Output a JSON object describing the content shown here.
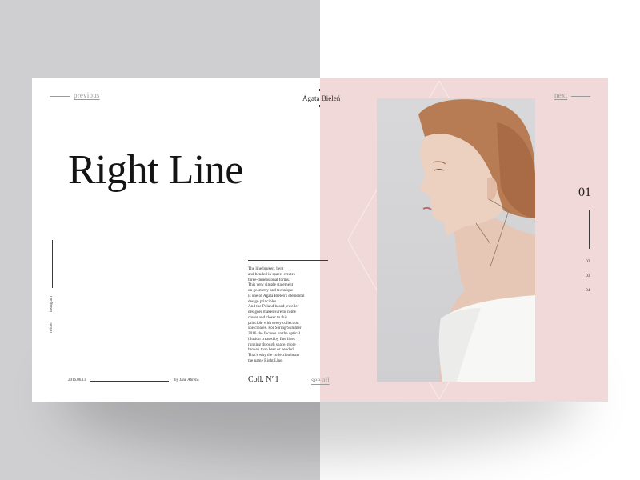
{
  "nav": {
    "previous_label": "previous",
    "next_label": "next"
  },
  "author": "Agata Bieleń",
  "article": {
    "title": "Right Line",
    "collection": "Coll. N°1",
    "see_all_label": "see all",
    "date": "2016.06.13",
    "byline": "by Jane Ahrens",
    "body_lines": [
      "The line broken, bent",
      "and bended in space, creates",
      "three-dimensional forms.",
      "This very simple statement",
      "on geometry and technique",
      "is one of Agata Bieleń's elemental",
      "design principles.",
      "And the Poland based jeweller",
      "designer makes sure to come",
      "closer and closer to this",
      "principle with every collection",
      "she creates. For Spring/Summer",
      "2016 she focuses on the optical",
      "illusion created by fine lines",
      "running through space, more",
      "broken than bent or bended.",
      "That's why the collection bears",
      "the name Right Line."
    ]
  },
  "social": {
    "instagram": "instagram",
    "twitter": "twitter"
  },
  "pagination": {
    "current": "01",
    "pages": [
      "02",
      "03",
      "04"
    ]
  },
  "colors": {
    "pink_panel": "#f0d9d8",
    "left_background": "#cfcfd1",
    "text": "#1c1c1c"
  }
}
